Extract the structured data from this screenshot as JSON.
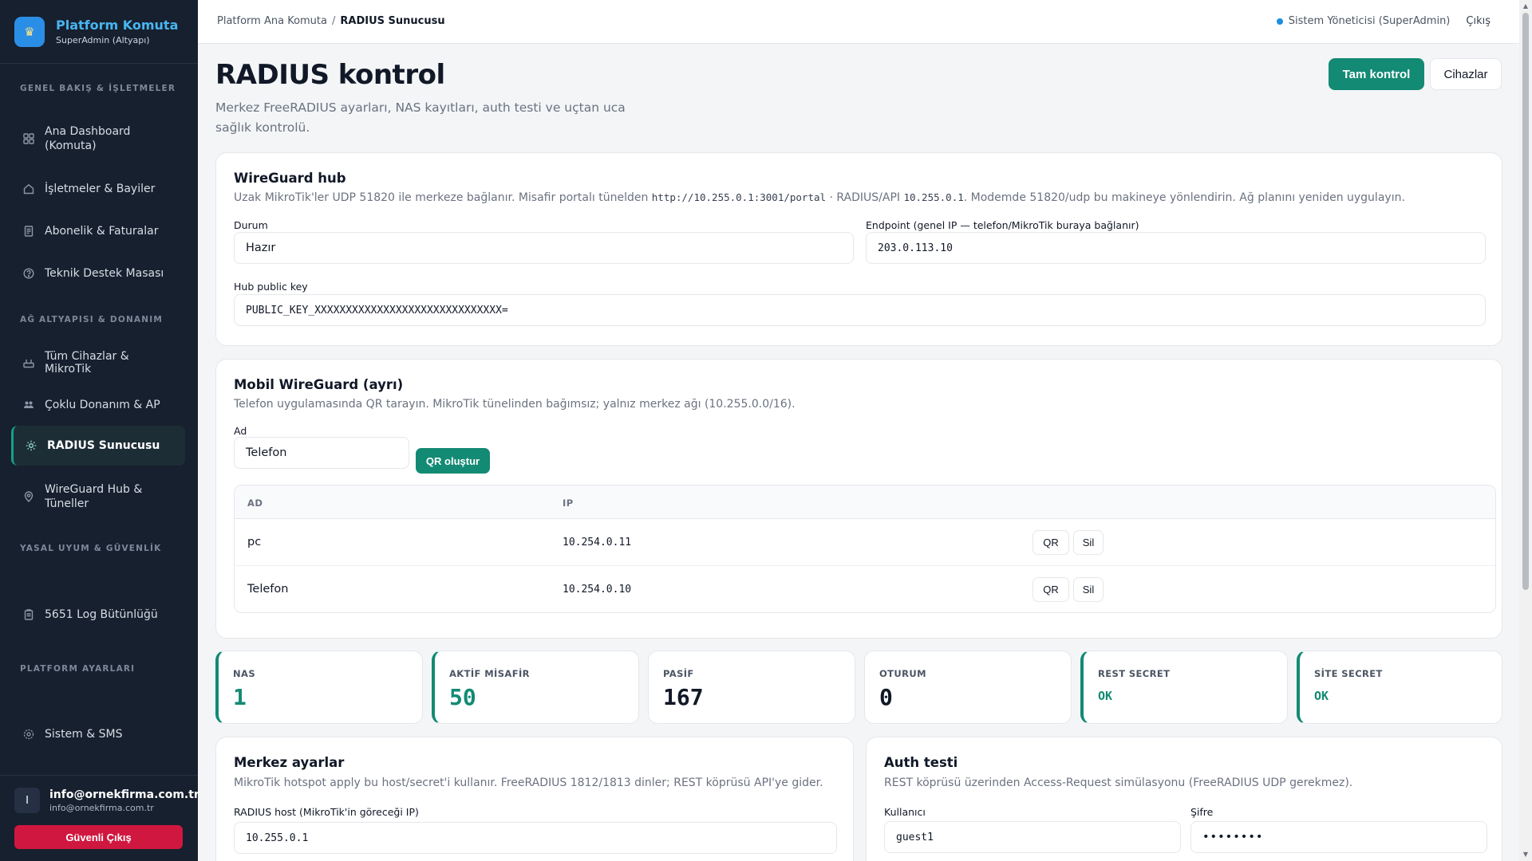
{
  "colors": {
    "accent": "#138a74",
    "sidebar_bg": "#17202e",
    "brand": "#48b6f0",
    "danger": "#d0173f",
    "status_dot": "#1d8fe0"
  },
  "sidebar": {
    "brand_title": "Platform Komuta",
    "brand_subtitle": "SuperAdmin (Altyapı)",
    "sections": {
      "overview": "GENEL BAKIŞ & İŞLETMELER",
      "network": "AĞ ALTYAPISI & DONANIM",
      "legal": "YASAL UYUM & GÜVENLİK",
      "platform": "PLATFORM AYARLARI"
    },
    "items": {
      "dashboard": {
        "label": "Ana Dashboard (Komuta)",
        "icon": "grid-icon"
      },
      "businesses": {
        "label": "İşletmeler & Bayiler",
        "icon": "home-icon"
      },
      "billing": {
        "label": "Abonelik & Faturalar",
        "icon": "document-icon"
      },
      "support": {
        "label": "Teknik Destek Masası",
        "icon": "help-icon"
      },
      "devices": {
        "label": "Tüm Cihazlar & MikroTik",
        "icon": "router-icon"
      },
      "hardware": {
        "label": "Çoklu Donanım & AP",
        "icon": "users-icon"
      },
      "radius": {
        "label": "RADIUS Sunucusu",
        "icon": "sun-icon"
      },
      "wireguard": {
        "label": "WireGuard Hub & Tüneller",
        "icon": "location-icon"
      },
      "log": {
        "label": "5651 Log Bütünlüğü",
        "icon": "clipboard-icon"
      },
      "system": {
        "label": "Sistem & SMS",
        "icon": "gear-icon"
      }
    },
    "user": {
      "initial": "I",
      "name": "info@ornekfirma.com.tr",
      "email": "info@ornekfirma.com.tr"
    },
    "logout_label": "Güvenli Çıkış"
  },
  "topbar": {
    "breadcrumb_root": "Platform Ana Komuta",
    "breadcrumb_sep": "/",
    "breadcrumb_current": "RADIUS Sunucusu",
    "role": "Sistem Yöneticisi (SuperAdmin)",
    "logout": "Çıkış"
  },
  "page": {
    "title": "RADIUS kontrol",
    "description": "Merkez FreeRADIUS ayarları, NAS kayıtları, auth testi ve uçtan uca sağlık kontrolü.",
    "btn_full_control": "Tam kontrol",
    "btn_devices": "Cihazlar"
  },
  "wireguard_hub": {
    "title": "WireGuard hub",
    "desc_1": "Uzak MikroTik'ler UDP 51820 ile merkeze bağlanır. Misafir portalı tünelden ",
    "desc_code_1": "http://10.255.0.1:3001/portal",
    "desc_2": " · RADIUS/API ",
    "desc_code_2": "10.255.0.1",
    "desc_3": ". Modemde 51820/udp bu makineye yönlendirin. Ağ planını yeniden uygulayın.",
    "status_label": "Durum",
    "status_value": "Hazır",
    "endpoint_label": "Endpoint (genel IP — telefon/MikroTik buraya bağlanır)",
    "endpoint_value": "203.0.113.10",
    "pubkey_label": "Hub public key",
    "pubkey_value": "PUBLIC_KEY_XXXXXXXXXXXXXXXXXXXXXXXXXXXXXX="
  },
  "mobile_wg": {
    "title": "Mobil WireGuard (ayrı)",
    "desc": "Telefon uygulamasında QR tarayın. MikroTik tünelinden bağımsız; yalnız merkez ağı (10.255.0.0/16).",
    "name_label": "Ad",
    "name_value": "Telefon",
    "create_btn": "QR oluştur",
    "columns": [
      "AD",
      "IP"
    ],
    "rows": [
      {
        "name": "pc",
        "ip": "10.254.0.11",
        "qr": "QR",
        "delete": "Sil"
      },
      {
        "name": "Telefon",
        "ip": "10.254.0.10",
        "qr": "QR",
        "delete": "Sil"
      }
    ]
  },
  "stats": [
    {
      "label": "NAS",
      "value": "1",
      "color": "#138a74"
    },
    {
      "label": "AKTİF MİSAFİR",
      "value": "50",
      "color": "#138a74"
    },
    {
      "label": "PASİF",
      "value": "167",
      "color": "#111827"
    },
    {
      "label": "OTURUM",
      "value": "0",
      "color": "#111827"
    },
    {
      "label": "REST SECRET",
      "value": "OK",
      "color": "#138a74"
    },
    {
      "label": "SİTE SECRET",
      "value": "OK",
      "color": "#138a74"
    }
  ],
  "center_settings": {
    "title": "Merkez ayarlar",
    "desc": "MikroTik hotspot apply bu host/secret'i kullanır. FreeRADIUS 1812/1813 dinler; REST köprüsü API'ye gider.",
    "host_label": "RADIUS host (MikroTik'in göreceği IP)",
    "host_value": "10.255.0.1"
  },
  "auth_test": {
    "title": "Auth testi",
    "desc": "REST köprüsü üzerinden Access-Request simülasyonu (FreeRADIUS UDP gerekmez).",
    "user_label": "Kullanıcı",
    "user_value": "guest1",
    "pass_label": "Şifre",
    "pass_value": "••••••••"
  }
}
